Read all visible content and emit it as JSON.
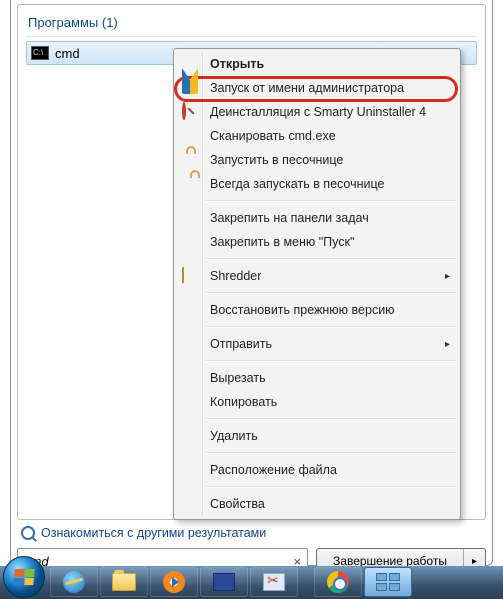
{
  "header": {
    "label": "Программы",
    "count": "(1)"
  },
  "result": {
    "name": "cmd"
  },
  "context_menu": {
    "open": "Открыть",
    "run_as_admin": "Запуск от имени администратора",
    "uninstall_smarty": "Деинсталляция с Smarty Uninstaller 4",
    "scan_cmd": "Сканировать cmd.exe",
    "run_sandbox": "Запустить в песочнице",
    "always_sandbox": "Всегда запускать в песочнице",
    "pin_taskbar": "Закрепить на панели задач",
    "pin_start": "Закрепить в меню \"Пуск\"",
    "shredder": "Shredder",
    "restore_prev": "Восстановить прежнюю версию",
    "send_to": "Отправить",
    "cut": "Вырезать",
    "copy_": "Копировать",
    "delete_": "Удалить",
    "open_location": "Расположение файла",
    "properties": "Свойства"
  },
  "see_more": "Ознакомиться с другими результатами",
  "search": {
    "value": "cmd",
    "clear_glyph": "×"
  },
  "shutdown": {
    "label": "Завершение работы",
    "arrow": "▸"
  },
  "submenu_arrow": "▸"
}
